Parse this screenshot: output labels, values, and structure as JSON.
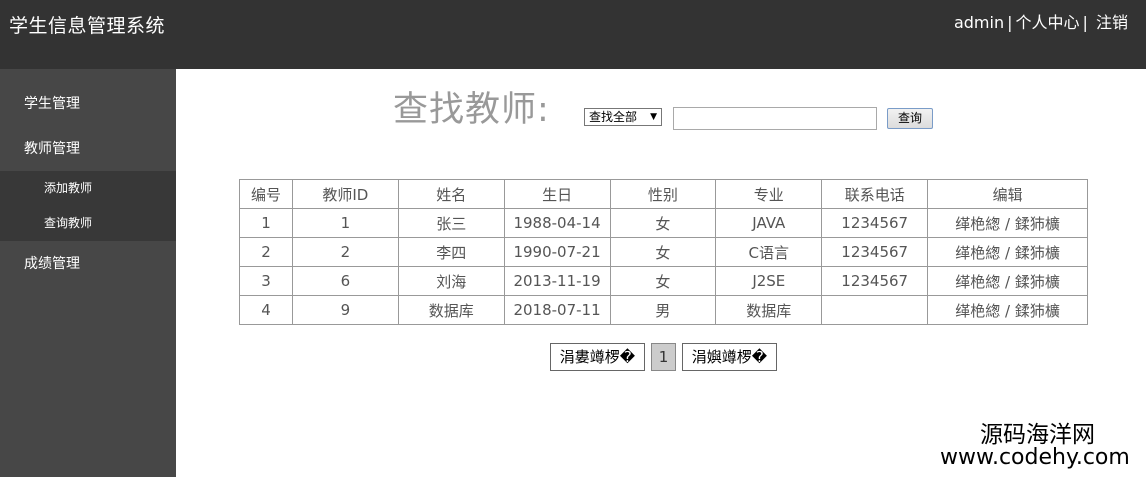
{
  "header": {
    "title": "学生信息管理系统",
    "user": "admin",
    "separator": "|",
    "profile": "个人中心",
    "logout": "注销"
  },
  "sidebar": {
    "items": [
      {
        "label": "学生管理"
      },
      {
        "label": "教师管理"
      },
      {
        "label": "成绩管理"
      }
    ],
    "sub_items": [
      {
        "label": "添加教师"
      },
      {
        "label": "查询教师"
      }
    ]
  },
  "search": {
    "title": "查找教师:",
    "select_value": "查找全部",
    "input_value": "",
    "button_label": "查询"
  },
  "table": {
    "headers": [
      "编号",
      "教师ID",
      "姓名",
      "生日",
      "性别",
      "专业",
      "联系电话",
      "编辑"
    ],
    "rows": [
      [
        "1",
        "1",
        "张三",
        "1988-04-14",
        "女",
        "JAVA",
        "1234567",
        "缂栬緫 / 鍒犻櫎"
      ],
      [
        "2",
        "2",
        "李四",
        "1990-07-21",
        "女",
        "C语言",
        "1234567",
        "缂栬緫 / 鍒犻櫎"
      ],
      [
        "3",
        "6",
        "刘海",
        "2013-11-19",
        "女",
        "J2SE",
        "1234567",
        "缂栬緫 / 鍒犻櫎"
      ],
      [
        "4",
        "9",
        "数据库",
        "2018-07-11",
        "男",
        "数据库",
        "",
        "缂栬緫 / 鍒犻櫎"
      ]
    ]
  },
  "pagination": {
    "prev_label": "涓婁竴椤�",
    "current_page": "1",
    "next_label": "涓嬩竴椤�"
  },
  "watermark": {
    "line1": "源码海洋网",
    "line2": "www.codehy.com"
  }
}
